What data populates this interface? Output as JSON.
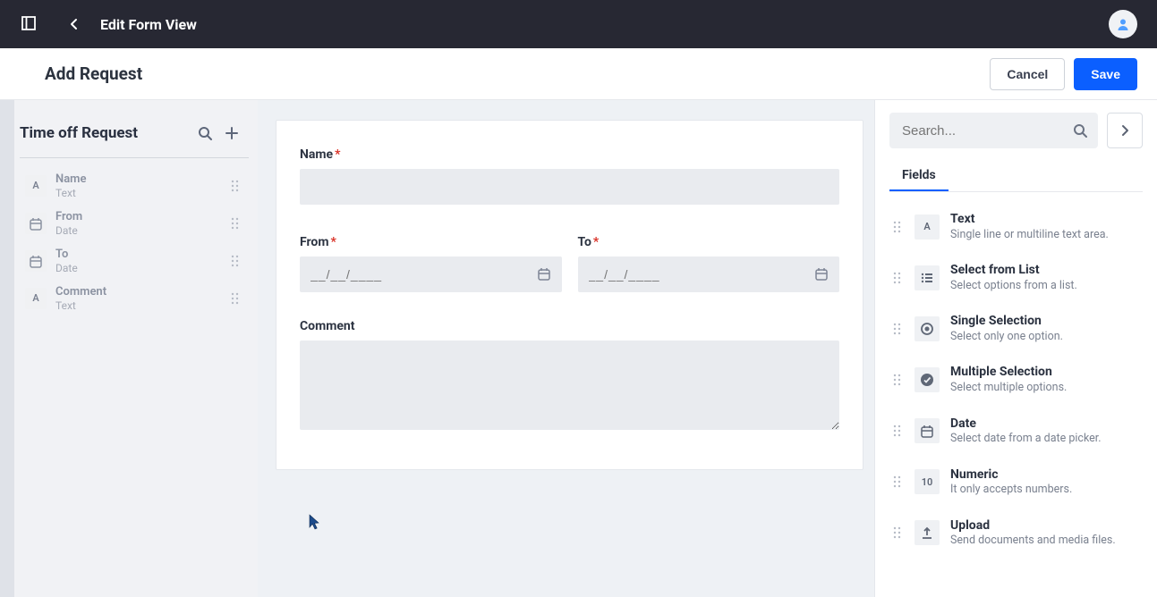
{
  "topbar": {
    "title": "Edit Form View"
  },
  "subheader": {
    "title": "Add Request",
    "cancel_label": "Cancel",
    "save_label": "Save"
  },
  "sidebar": {
    "title": "Time off Request",
    "items": [
      {
        "label": "Name",
        "type": "Text",
        "icon": "A"
      },
      {
        "label": "From",
        "type": "Date",
        "icon": "cal"
      },
      {
        "label": "To",
        "type": "Date",
        "icon": "cal"
      },
      {
        "label": "Comment",
        "type": "Text",
        "icon": "A"
      }
    ]
  },
  "form": {
    "name_label": "Name",
    "from_label": "From",
    "to_label": "To",
    "comment_label": "Comment",
    "date_placeholder": "__/__/____"
  },
  "right": {
    "search_placeholder": "Search...",
    "tab_label": "Fields",
    "field_types": [
      {
        "icon": "A",
        "label": "Text",
        "desc": "Single line or multiline text area."
      },
      {
        "icon": "list",
        "label": "Select from List",
        "desc": "Select options from a list."
      },
      {
        "icon": "radio",
        "label": "Single Selection",
        "desc": "Select only one option."
      },
      {
        "icon": "check",
        "label": "Multiple Selection",
        "desc": "Select multiple options."
      },
      {
        "icon": "cal",
        "label": "Date",
        "desc": "Select date from a date picker."
      },
      {
        "icon": "10",
        "label": "Numeric",
        "desc": "It only accepts numbers."
      },
      {
        "icon": "upload",
        "label": "Upload",
        "desc": "Send documents and media files."
      }
    ]
  }
}
